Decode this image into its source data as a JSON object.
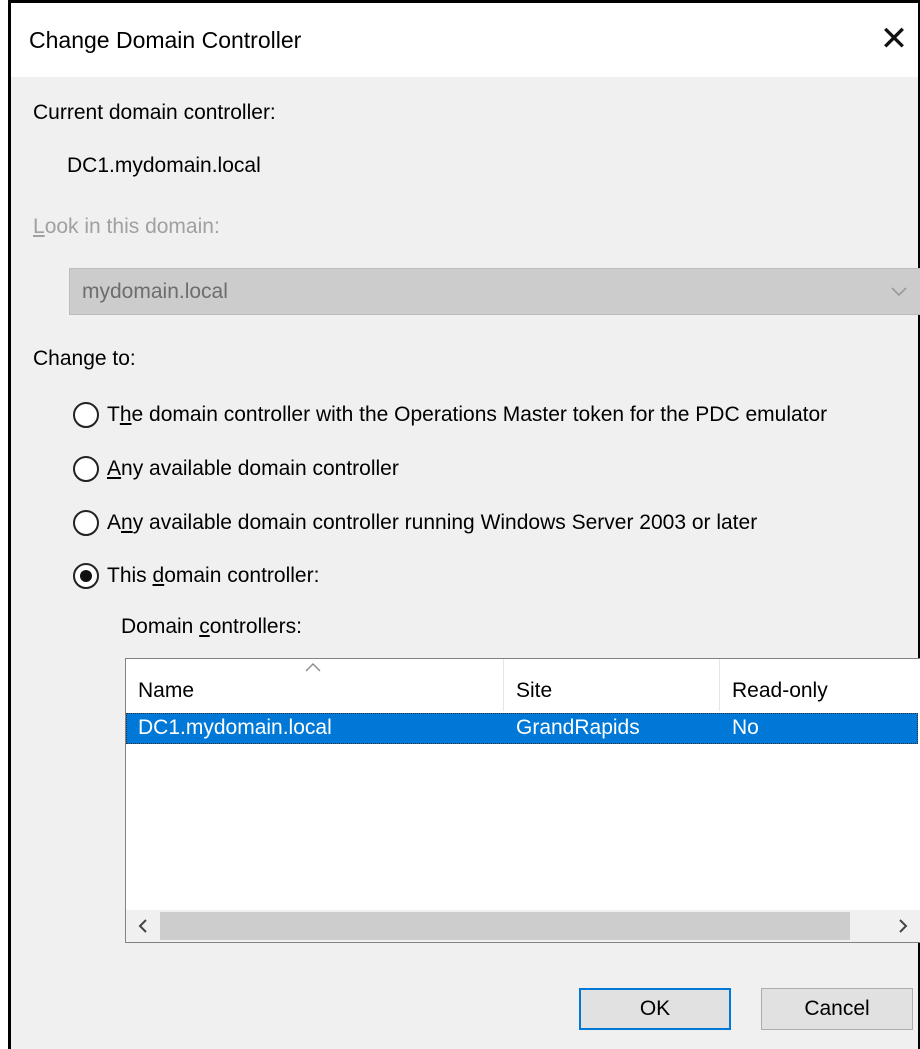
{
  "window": {
    "title": "Change Domain Controller",
    "close_icon": "close-icon"
  },
  "current_dc": {
    "label": "Current domain controller:",
    "value": "DC1.mydomain.local"
  },
  "look_in": {
    "label_accel": "L",
    "label_rest": "ook in this domain:",
    "selected": "mydomain.local",
    "enabled": false
  },
  "change_to": {
    "label": "Change to:",
    "options": [
      {
        "pre": "T",
        "accel": "h",
        "post": "e domain controller with the Operations Master token for the PDC emulator",
        "checked": false
      },
      {
        "pre": "",
        "accel": "A",
        "post": "ny available domain controller",
        "checked": false
      },
      {
        "pre": "A",
        "accel": "n",
        "post": "y available domain controller running Windows Server 2003 or later",
        "checked": false
      },
      {
        "pre": "This ",
        "accel": "d",
        "post": "omain controller:",
        "checked": true
      }
    ]
  },
  "dc_list": {
    "label_pre": "Domain ",
    "label_accel": "c",
    "label_post": "ontrollers:",
    "columns": [
      "Name",
      "Site",
      "Read-only"
    ],
    "sorted_column": "Name",
    "rows": [
      {
        "name": "DC1.mydomain.local",
        "site": "GrandRapids",
        "read_only": "No",
        "selected": true
      }
    ],
    "scroll_left_icon": "chevron-left-icon",
    "scroll_right_icon": "chevron-right-icon"
  },
  "buttons": {
    "ok": "OK",
    "cancel": "Cancel"
  },
  "colors": {
    "selection": "#0078d7",
    "dialog_bg": "#f0f0f0",
    "disabled_text": "#a0a0a0"
  }
}
